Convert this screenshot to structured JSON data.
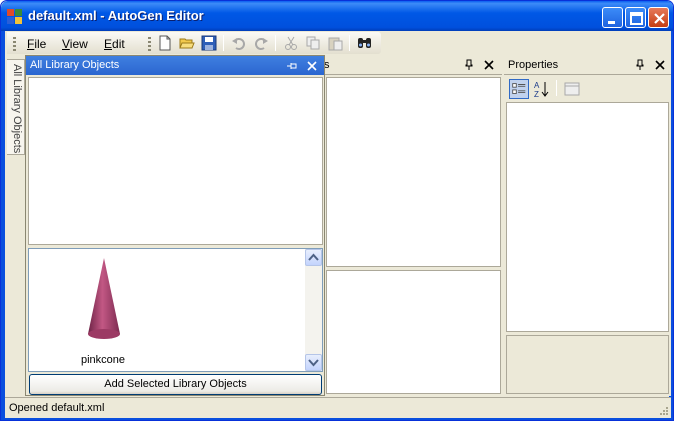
{
  "window": {
    "title": "default.xml - AutoGen Editor"
  },
  "menu": {
    "file_pre": "",
    "file_key": "F",
    "file_post": "ile",
    "view_pre": "",
    "view_key": "V",
    "view_post": "iew",
    "edit_pre": "",
    "edit_key": "E",
    "edit_post": "dit"
  },
  "toolbar": {
    "icons": [
      "new-file-icon",
      "open-folder-icon",
      "save-icon",
      "undo-icon",
      "redo-icon",
      "cut-icon",
      "copy-icon",
      "paste-icon",
      "find-icon"
    ]
  },
  "sidetab": {
    "label": "All Library Objects"
  },
  "library_panel": {
    "title": "All Library Objects",
    "items": [
      {
        "label": "pinkcone",
        "icon": "cone-icon",
        "color": "#B0446E"
      }
    ],
    "add_button_label": "Add Selected Library Objects"
  },
  "doc_pane": {
    "title_fragment": "s"
  },
  "properties": {
    "title": "Properties",
    "icons": [
      "categorized-icon",
      "alphabetical-icon",
      "property-pages-icon"
    ]
  },
  "status": {
    "text": "Opened default.xml"
  },
  "colors": {
    "titlebar": "#0058E6",
    "panel_active_header": "#3A75DA",
    "chrome": "#ECE9D8"
  }
}
